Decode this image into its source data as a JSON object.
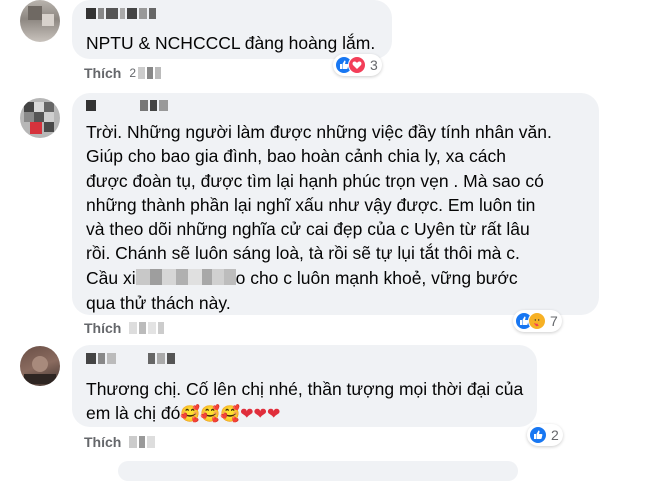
{
  "colors": {
    "bubble": "#f0f2f5",
    "action": "#65676b",
    "like": "#1877f2",
    "love": "#f33e58",
    "care": "#f7b125",
    "heart": "#e02e3b"
  },
  "comments": [
    {
      "text": "NPTU & NCHCCCL đàng hoàng lắm.",
      "action_label": "Thích",
      "time_prefix": "2",
      "reaction_icons": [
        "like-icon",
        "love-icon"
      ],
      "reaction_count": "3"
    },
    {
      "text_before": "Trời. Những người làm được những việc đầy tính nhân văn.\nGiúp cho bao gia đình, bao hoàn cảnh chia ly, xa cách\nđược đoàn tụ, được tìm lại hạnh phúc trọn vẹn . Mà sao có\nnhững thành phần lại nghĩ xấu như vậy được. Em luôn tin\nvà theo dõi những nghĩa cử cai đẹp của c Uyên từ rất lâu\nrồi. Chánh sẽ luôn sáng loà, tà rồi sẽ tự lụi tắt thôi mà c.\nCầu xi",
      "text_after": "o cho c luôn mạnh khoẻ, vững bước\nqua thử thách này.",
      "action_label": "Thích",
      "reaction_icons": [
        "like-icon",
        "care-icon"
      ],
      "reaction_count": "7"
    },
    {
      "text": "Thương chị. Cố lên chị nhé, thần tượng mọi thời đại của\nem là chị đó",
      "emoji": "🥰🥰🥰❤❤❤",
      "action_label": "Thích",
      "reaction_icons": [
        "like-icon"
      ],
      "reaction_count": "2"
    }
  ]
}
